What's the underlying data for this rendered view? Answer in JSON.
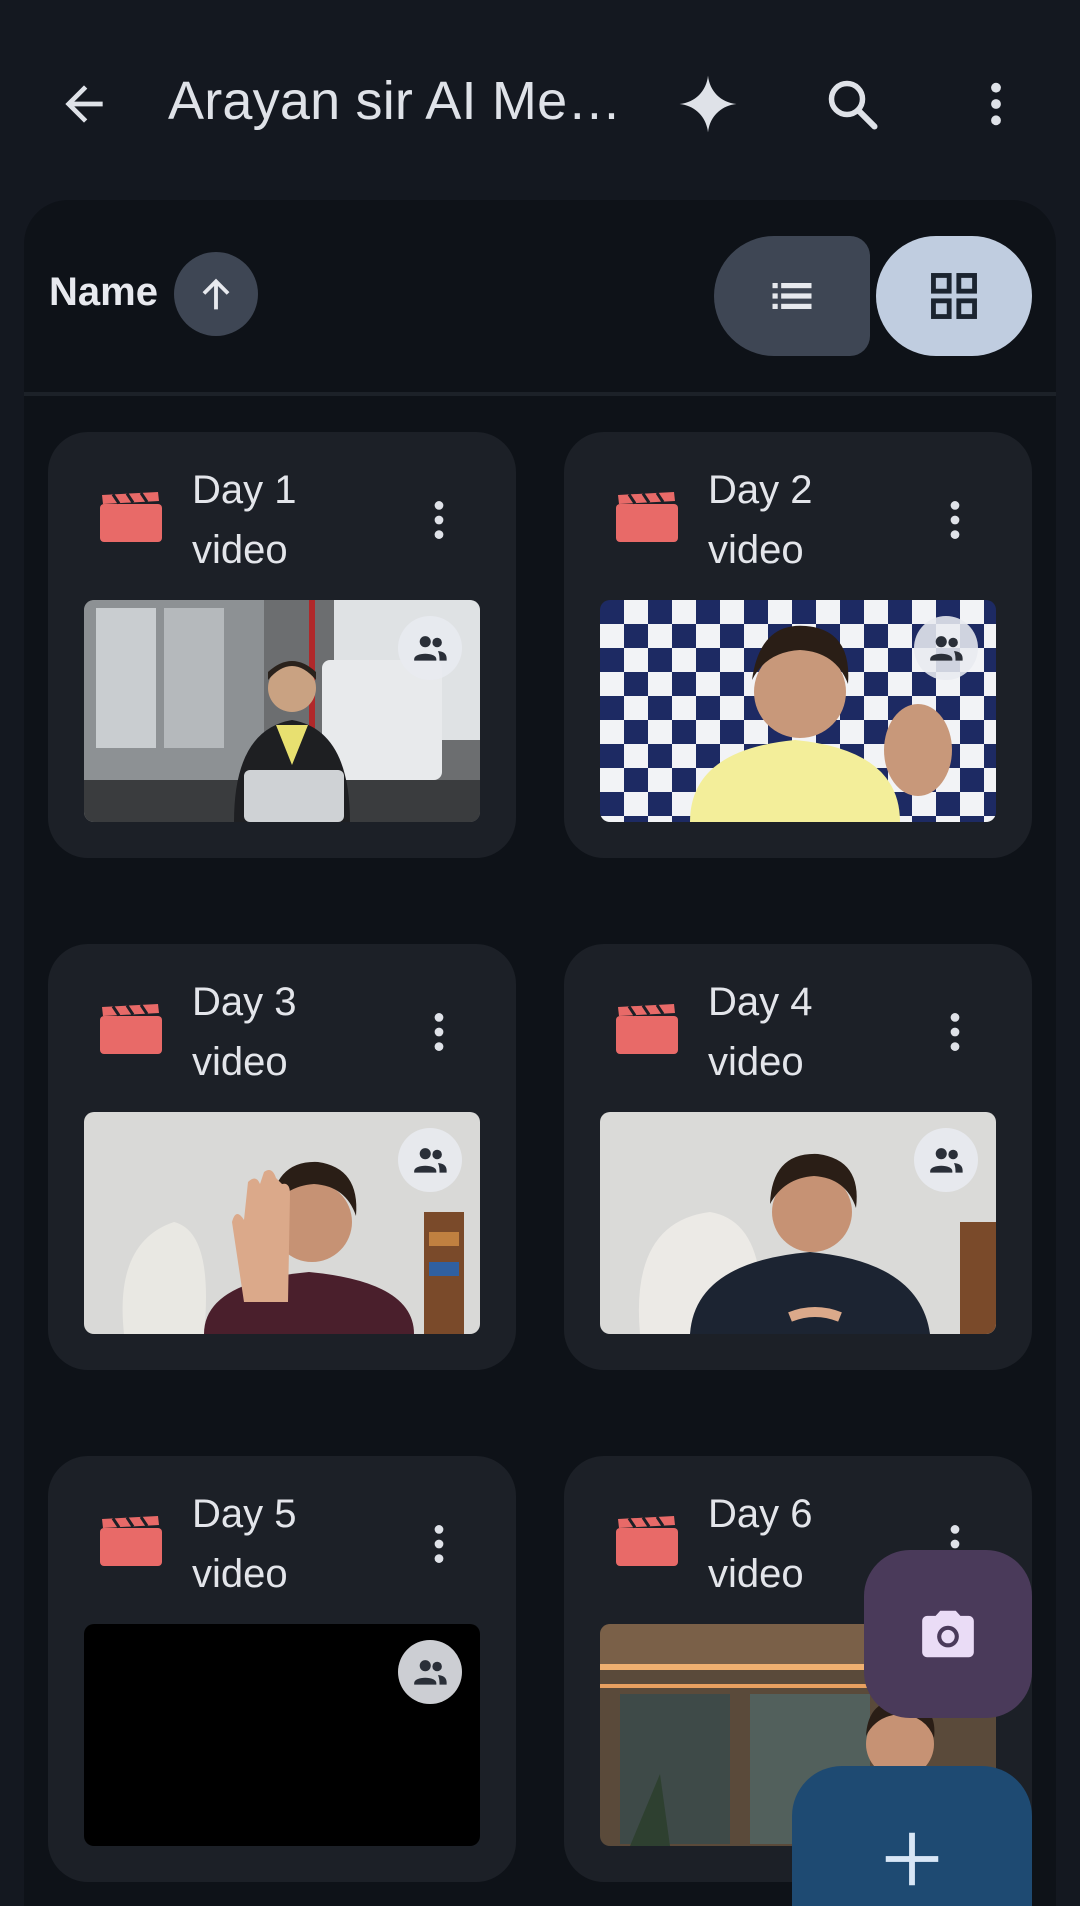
{
  "appbar": {
    "title": "Arayan sir AI Met...",
    "icons": [
      "back-arrow-icon",
      "gemini-sparkle-icon",
      "search-icon",
      "more-vert-icon"
    ]
  },
  "sort": {
    "label": "Name",
    "direction": "ascending",
    "view_mode": "grid"
  },
  "files": [
    {
      "title": "Day 1 video",
      "type": "video",
      "shared": true,
      "thumbnail": "man in black suit at desk with microphone and computer"
    },
    {
      "title": "Day 2 video",
      "type": "video",
      "shared": true,
      "thumbnail": "man in yellow t-shirt in front of checkered LEARN backdrop"
    },
    {
      "title": "Day 3 video",
      "type": "video",
      "shared": true,
      "thumbnail": "man in maroon shirt waving hand"
    },
    {
      "title": "Day 4 video",
      "type": "video",
      "shared": true,
      "thumbnail": "man in dark sweater in front of white chair"
    },
    {
      "title": "Day 5 video",
      "type": "video",
      "shared": true,
      "thumbnail": "black frame"
    },
    {
      "title": "Day 6 video",
      "type": "video",
      "shared": false,
      "thumbnail": "man in office with warm lights"
    }
  ],
  "colors": {
    "background": "#141820",
    "panel": "#0e1218",
    "card": "#1c2027",
    "video_icon": "#e86a68",
    "grid_toggle_active": "#c0cde0",
    "camera_fab": "#4a3a5a",
    "add_fab": "#1e4a72"
  }
}
